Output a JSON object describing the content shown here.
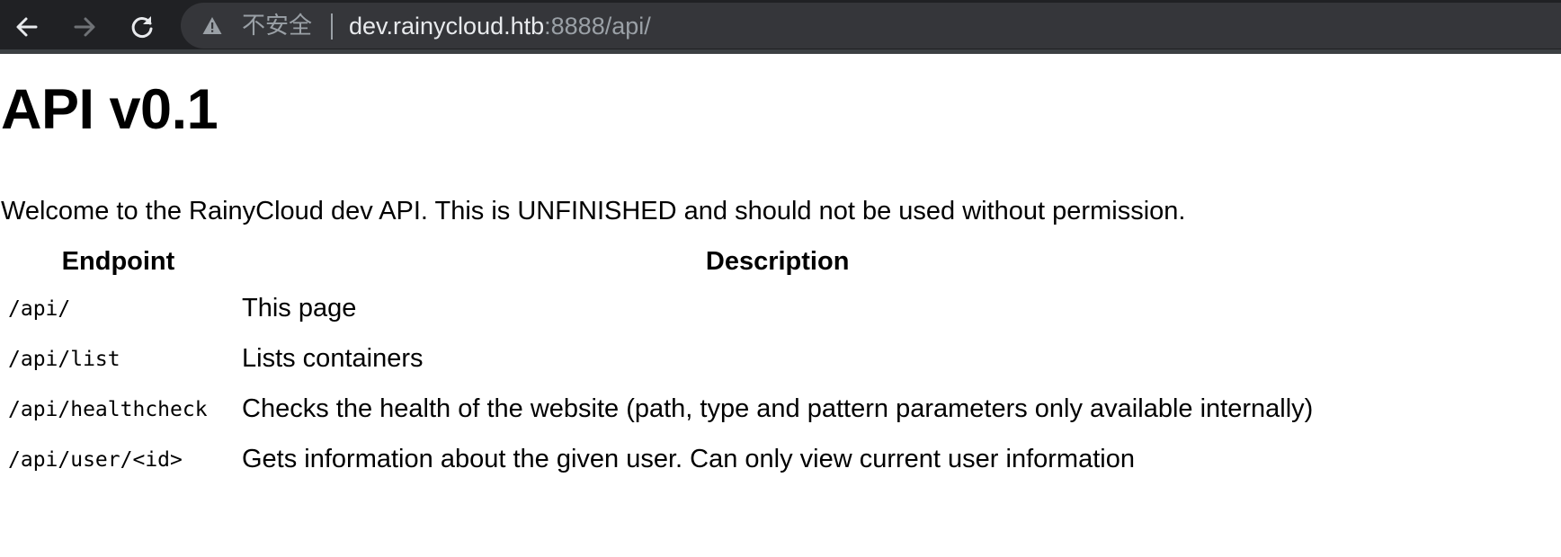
{
  "browser": {
    "security_label": "不安全",
    "url_host": "dev.rainycloud.htb",
    "url_rest": ":8888/api/",
    "icons": {
      "back": "arrow-left-icon",
      "forward": "arrow-right-icon",
      "reload": "reload-icon",
      "security": "warning-triangle-icon"
    }
  },
  "page": {
    "title": "API v0.1",
    "welcome": "Welcome to the RainyCloud dev API. This is UNFINISHED and should not be used without permission.",
    "table": {
      "headers": [
        "Endpoint",
        "Description"
      ],
      "rows": [
        {
          "endpoint": "/api/",
          "description": "This page"
        },
        {
          "endpoint": "/api/list",
          "description": "Lists containers"
        },
        {
          "endpoint": "/api/healthcheck",
          "description": "Checks the health of the website (path, type and pattern parameters only available internally)"
        },
        {
          "endpoint": "/api/user/<id>",
          "description": "Gets information about the given user. Can only view current user information"
        }
      ]
    }
  }
}
